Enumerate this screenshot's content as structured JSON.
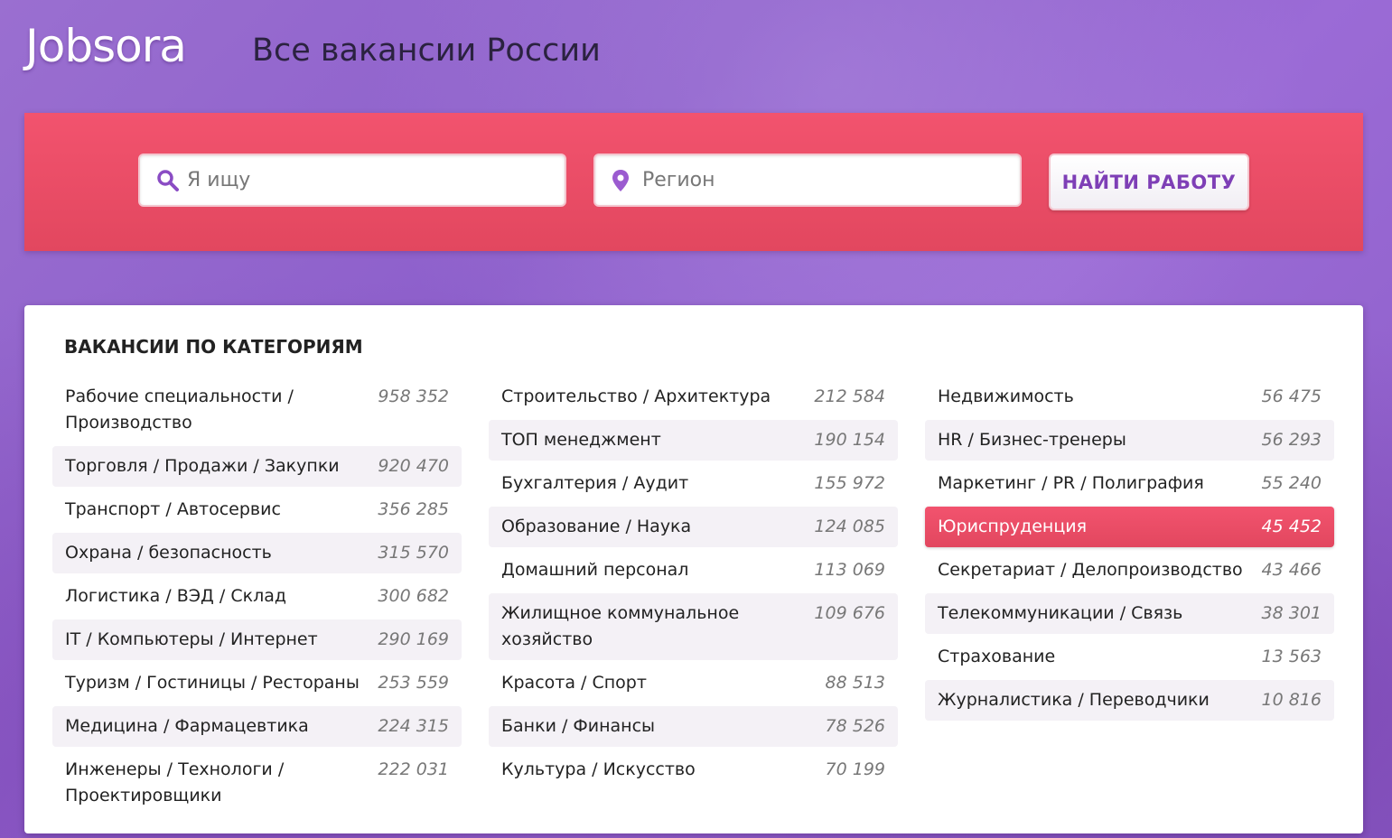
{
  "header": {
    "logo": "Jobsora",
    "tagline": "Все вакансии России"
  },
  "search": {
    "query_placeholder": "Я ищу",
    "query_value": "",
    "region_placeholder": "Регион",
    "region_value": "",
    "query_icon": "search-icon",
    "region_icon": "map-pin-icon",
    "button_label": "НАЙТИ РАБОТУ"
  },
  "colors": {
    "accent": "#e94b65",
    "brand_purple": "#7e3fb6"
  },
  "categories": {
    "title": "ВАКАНСИИ ПО КАТЕГОРИЯМ",
    "active": "Юриспруденция",
    "columns": [
      [
        {
          "name": "Рабочие специальности / Производство",
          "count": "958 352"
        },
        {
          "name": "Торговля / Продажи / Закупки",
          "count": "920 470"
        },
        {
          "name": "Транспорт / Автосервис",
          "count": "356 285"
        },
        {
          "name": "Охрана / безопасность",
          "count": "315 570"
        },
        {
          "name": "Логистика / ВЭД / Склад",
          "count": "300 682"
        },
        {
          "name": "IT / Компьютеры / Интернет",
          "count": "290 169"
        },
        {
          "name": "Туризм / Гостиницы / Рестораны",
          "count": "253 559"
        },
        {
          "name": "Медицина / Фармацевтика",
          "count": "224 315"
        },
        {
          "name": "Инженеры / Технологи / Проектировщики",
          "count": "222 031"
        }
      ],
      [
        {
          "name": "Строительство / Архитектура",
          "count": "212 584"
        },
        {
          "name": "ТОП менеджмент",
          "count": "190 154"
        },
        {
          "name": "Бухгалтерия / Аудит",
          "count": "155 972"
        },
        {
          "name": "Образование / Наука",
          "count": "124 085"
        },
        {
          "name": "Домашний персонал",
          "count": "113 069"
        },
        {
          "name": "Жилищное коммунальное хозяйство",
          "count": "109 676"
        },
        {
          "name": "Красота / Спорт",
          "count": "88 513"
        },
        {
          "name": "Банки / Финансы",
          "count": "78 526"
        },
        {
          "name": "Культура / Искусство",
          "count": "70 199"
        }
      ],
      [
        {
          "name": "Недвижимость",
          "count": "56 475"
        },
        {
          "name": "HR / Бизнес-тренеры",
          "count": "56 293"
        },
        {
          "name": "Маркетинг / PR / Полиграфия",
          "count": "55 240"
        },
        {
          "name": "Юриспруденция",
          "count": "45 452"
        },
        {
          "name": "Секретариат / Делопроизводство",
          "count": "43 466"
        },
        {
          "name": "Телекоммуникации / Связь",
          "count": "38 301"
        },
        {
          "name": "Страхование",
          "count": "13 563"
        },
        {
          "name": "Журналистика / Переводчики",
          "count": "10 816"
        }
      ]
    ]
  }
}
